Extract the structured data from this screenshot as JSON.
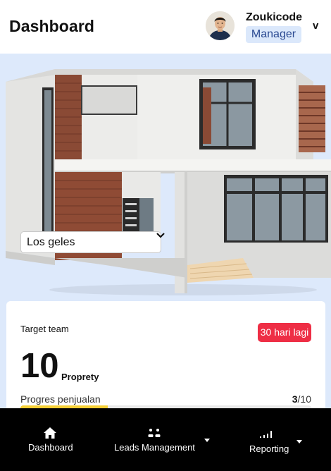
{
  "header": {
    "title": "Dashboard",
    "user": {
      "name": "Zoukicode",
      "role": "Manager",
      "caret": "v"
    }
  },
  "hero": {
    "location_select": {
      "value": "Los geles"
    }
  },
  "target_card": {
    "label": "Target team",
    "deadline_badge": "30 hari lagi",
    "big_number": "10",
    "unit": "Proprety",
    "progress_label": "Progres penjualan",
    "progress_current": "3",
    "progress_total": "/10",
    "progress_fraction": 0.3
  },
  "bottom_nav": {
    "items": [
      {
        "label": "Dashboard",
        "icon": "home-icon"
      },
      {
        "label": "Leads Management",
        "icon": "users-icon"
      },
      {
        "label": "Reporting",
        "icon": "signal-bars-icon"
      }
    ]
  },
  "colors": {
    "hero_background": "#dde9fb",
    "badge_red": "#ee2e45",
    "progress_yellow": "#f6cf35",
    "role_badge_bg": "#dbe8fb",
    "nav_background": "#000000"
  }
}
